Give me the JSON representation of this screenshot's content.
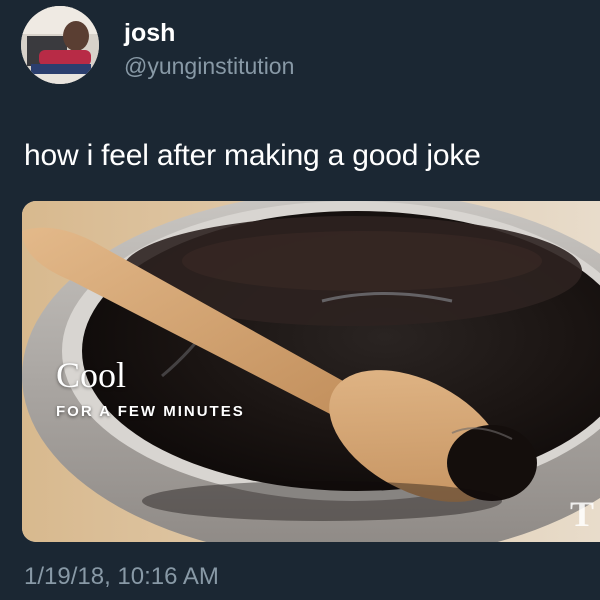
{
  "tweet": {
    "display_name": "josh",
    "handle": "@yunginstitution",
    "text": "how i feel after making a good joke",
    "timestamp": "1/19/18, 10:16 AM"
  },
  "media": {
    "caption_title": "Cool",
    "caption_subtitle": "FOR A FEW MINUTES",
    "watermark": "T"
  },
  "colors": {
    "background": "#1b2733",
    "name_text": "#ffffff",
    "secondary_text": "#8899a6"
  }
}
